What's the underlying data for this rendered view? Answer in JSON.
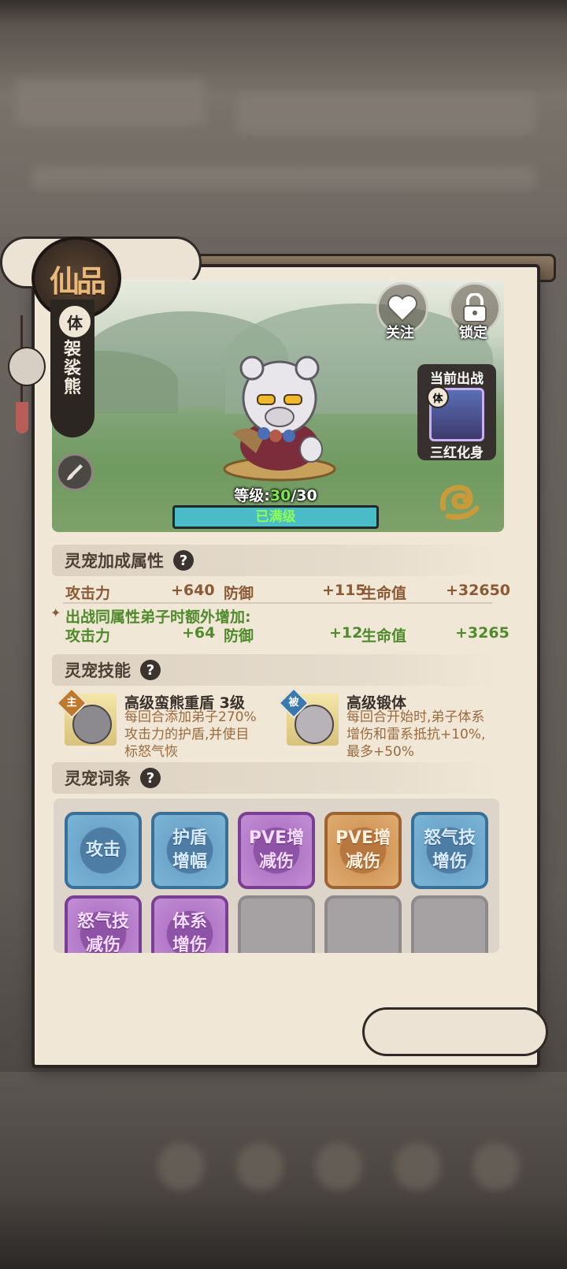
{
  "pet": {
    "grade": "仙品",
    "element": "体",
    "name": "袈裟熊",
    "level_label": "等级:",
    "level_current": "30",
    "level_max": "/30",
    "max_level_text": "已满级"
  },
  "actions": {
    "follow_label": "关注",
    "lock_label": "锁定"
  },
  "battle": {
    "title": "当前出战",
    "element": "体",
    "disciple_name": "三红化身"
  },
  "bonus": {
    "title": "灵宠加成属性",
    "help": "?",
    "stats": [
      {
        "label": "攻击力",
        "value": "+640"
      },
      {
        "label": "防御",
        "value": "+115"
      },
      {
        "label": "生命值",
        "value": "+32650"
      }
    ],
    "extra_title": "出战同属性弟子时额外增加:",
    "extra_stats": [
      {
        "label": "攻击力",
        "value": "+64"
      },
      {
        "label": "防御",
        "value": "+12"
      },
      {
        "label": "生命值",
        "value": "+3265"
      }
    ]
  },
  "skills": {
    "title": "灵宠技能",
    "help": "?",
    "items": [
      {
        "tag": "主",
        "name": "高级蛮熊重盾 3级",
        "desc": "每回合添加弟子270%攻击力的护盾,并使目标怒气恢"
      },
      {
        "tag": "被",
        "name": "高级锻体",
        "desc": "每回合开始时,弟子体系增伤和雷系抵抗+10%,最多+50%"
      }
    ]
  },
  "entries": {
    "title": "灵宠词条",
    "help": "?",
    "slots": [
      {
        "line1": "攻击",
        "line2": "",
        "color": "blue"
      },
      {
        "line1": "护盾",
        "line2": "增幅",
        "color": "blue"
      },
      {
        "line1": "PVE增",
        "line2": "减伤",
        "color": "purple"
      },
      {
        "line1": "PVE增",
        "line2": "减伤",
        "color": "orange"
      },
      {
        "line1": "怒气技",
        "line2": "增伤",
        "color": "blue"
      },
      {
        "line1": "怒气技",
        "line2": "减伤",
        "color": "purple"
      },
      {
        "line1": "体系",
        "line2": "增伤",
        "color": "purple"
      },
      {
        "line1": "",
        "line2": "",
        "color": "empty"
      },
      {
        "line1": "",
        "line2": "",
        "color": "empty"
      },
      {
        "line1": "",
        "line2": "",
        "color": "empty"
      }
    ]
  },
  "icons": [
    "heart-icon",
    "lock-icon",
    "brush-icon",
    "cloud-swirl-icon",
    "question-icon",
    "sparkle-icon"
  ],
  "colors": {
    "panel_bg": "#f0e7d7",
    "stat_text": "#8a5a34",
    "bonus_text": "#4f8a2b",
    "max_bar": "#49bcc7"
  }
}
